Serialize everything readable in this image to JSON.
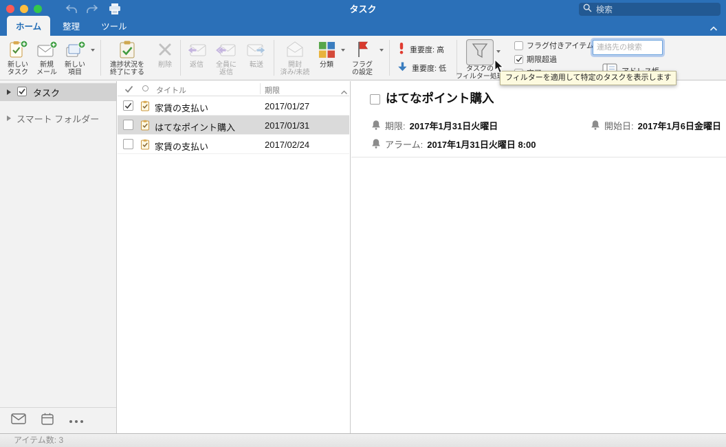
{
  "titlebar": {
    "title": "タスク",
    "search_placeholder": "検索"
  },
  "tabs": {
    "home": "ホーム",
    "organize": "整理",
    "tools": "ツール"
  },
  "ribbon": {
    "new_task": "新しい\nタスク",
    "new_mail": "新規\nメール",
    "new_item": "新しい\n項目",
    "mark_complete": "進捗状況を\n終了にする",
    "delete": "削除",
    "reply": "返信",
    "reply_all": "全員に\n返信",
    "forward": "転送",
    "read_unread": "開封\n済み/未読",
    "categorize": "分類",
    "flag": "フラグ\nの設定",
    "importance_high": "重要度: 高",
    "importance_low": "重要度: 低",
    "filter_tasks": "タスクの\nフィルター処理",
    "cb_flagged": "フラグ付きアイテム",
    "cb_overdue": "期限超過",
    "cb_done": "完了",
    "contact_search_placeholder": "連絡先の検索",
    "address_book": "アドレス帳",
    "tooltip": "フィルターを適用して特定のタスクを表示します"
  },
  "sidebar": {
    "tasks": "タスク",
    "smart_folders": "スマート フォルダー"
  },
  "tasklist": {
    "col_title": "タイトル",
    "col_due": "期限",
    "rows": [
      {
        "title": "家賃の支払い",
        "due": "2017/01/27",
        "checked": true
      },
      {
        "title": "はてなポイント購入",
        "due": "2017/01/31",
        "checked": false
      },
      {
        "title": "家賃の支払い",
        "due": "2017/02/24",
        "checked": false
      }
    ]
  },
  "detail": {
    "title": "はてなポイント購入",
    "due_label": "期限:",
    "due_value": "2017年1月31日火曜日",
    "start_label": "開始日:",
    "start_value": "2017年1月6日金曜日",
    "alarm_label": "アラーム:",
    "alarm_value": "2017年1月31日火曜日 8:00"
  },
  "statusbar": {
    "item_count": "アイテム数: 3"
  }
}
